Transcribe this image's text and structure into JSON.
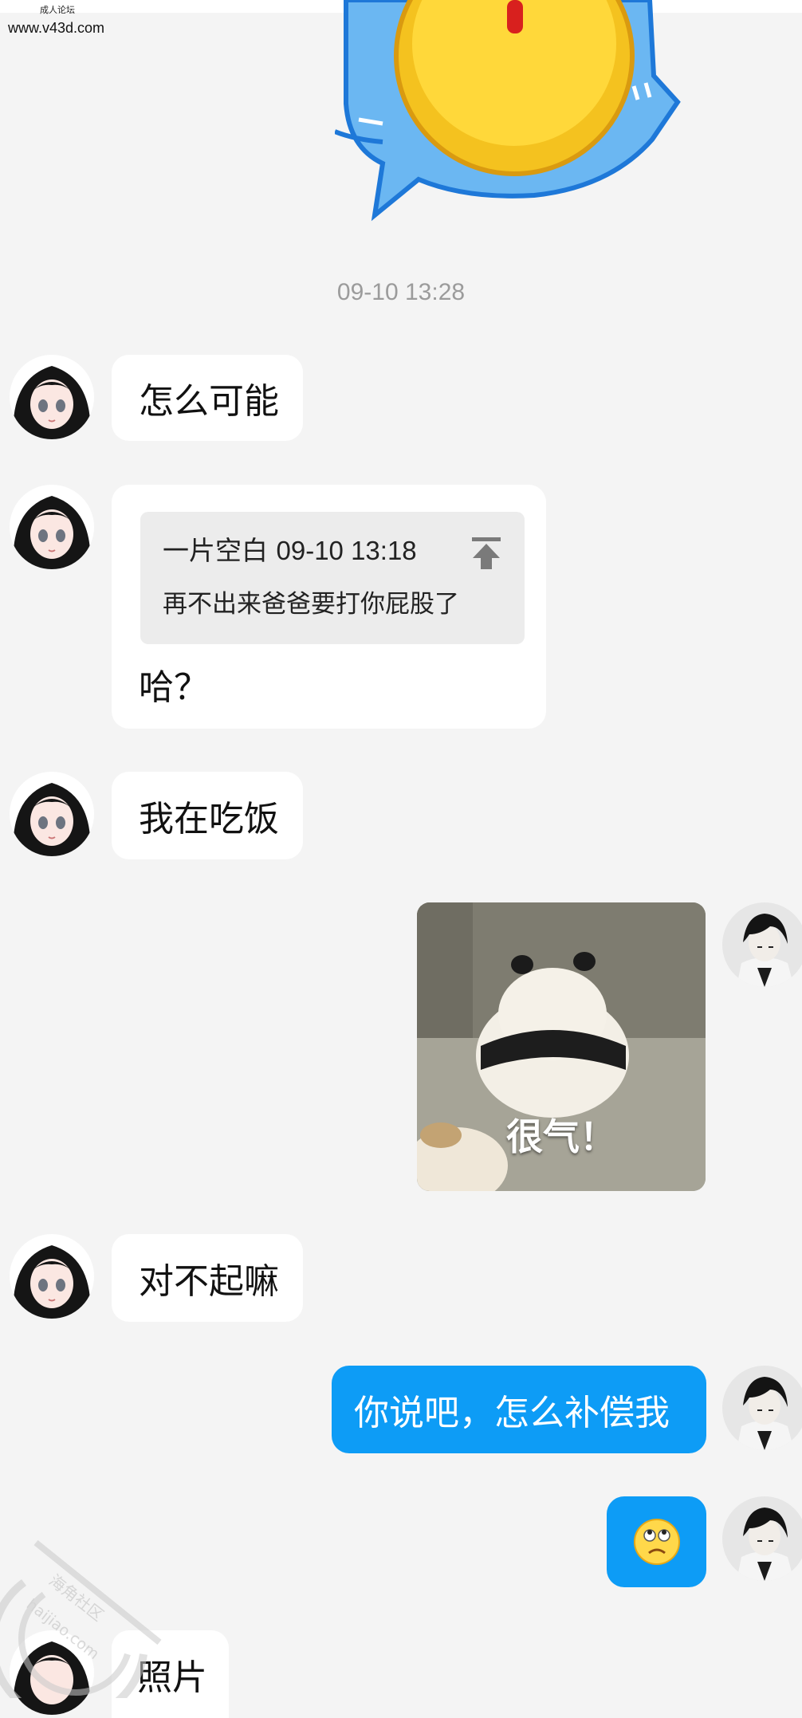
{
  "header": {
    "site_tag": "成人论坛",
    "site_url": "www.v43d.com"
  },
  "timestamp": "09-10 13:28",
  "messages": [
    {
      "side": "left",
      "text": "怎么可能"
    },
    {
      "side": "left",
      "quote": {
        "author": "一片空白",
        "time": "09-10 13:18",
        "text": "再不出来爸爸要打你屁股了"
      },
      "text": "哈？"
    },
    {
      "side": "left",
      "text": "我在吃饭"
    },
    {
      "side": "right",
      "image_caption": "很气！"
    },
    {
      "side": "left",
      "text": "对不起嘛"
    },
    {
      "side": "right",
      "text": "你说吧，怎么补偿我"
    },
    {
      "side": "right",
      "emoji": "eye-roll-face-icon"
    },
    {
      "side": "left",
      "text": "照片"
    }
  ],
  "watermark": {
    "line1": "海角社区",
    "line2": "haijiao.com"
  },
  "colors": {
    "background": "#f4f4f4",
    "incoming_bubble": "#ffffff",
    "outgoing_bubble": "#0d9cf6",
    "quote_box": "#ececec",
    "timestamp": "#9b9b9b"
  }
}
